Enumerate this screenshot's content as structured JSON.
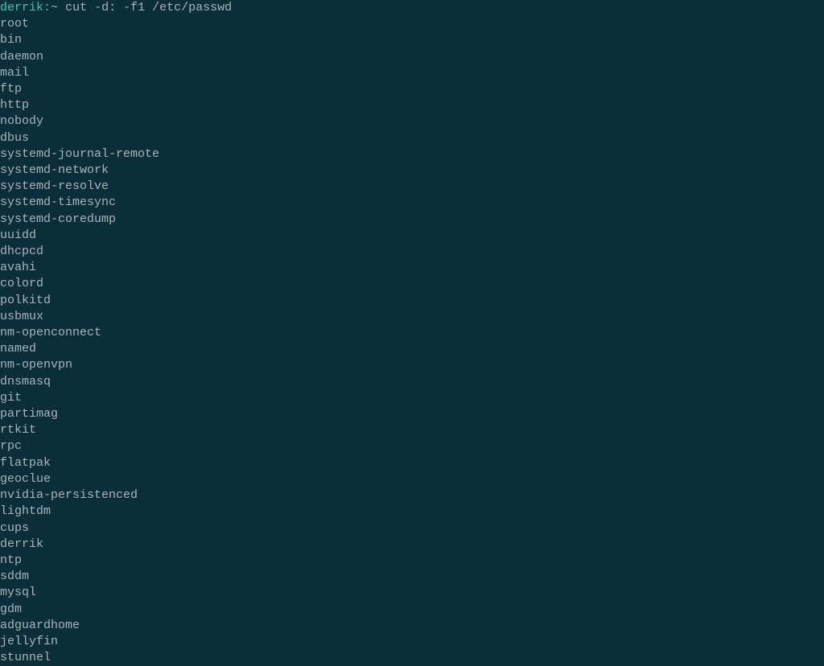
{
  "prompt": {
    "user": "derrik",
    "sep": ":",
    "path": "~",
    "command": "cut -d: -f1 /etc/passwd"
  },
  "output": [
    "root",
    "bin",
    "daemon",
    "mail",
    "ftp",
    "http",
    "nobody",
    "dbus",
    "systemd-journal-remote",
    "systemd-network",
    "systemd-resolve",
    "systemd-timesync",
    "systemd-coredump",
    "uuidd",
    "dhcpcd",
    "avahi",
    "colord",
    "polkitd",
    "usbmux",
    "nm-openconnect",
    "named",
    "nm-openvpn",
    "dnsmasq",
    "git",
    "partimag",
    "rtkit",
    "rpc",
    "flatpak",
    "geoclue",
    "nvidia-persistenced",
    "lightdm",
    "cups",
    "derrik",
    "ntp",
    "sddm",
    "mysql",
    "gdm",
    "adguardhome",
    "jellyfin",
    "stunnel"
  ]
}
